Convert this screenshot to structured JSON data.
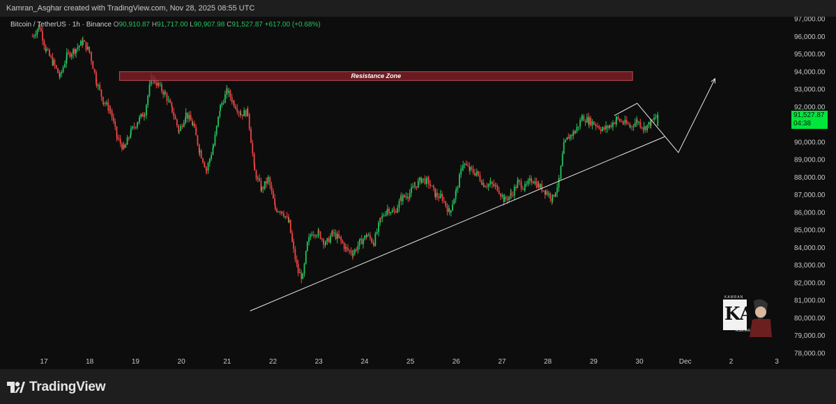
{
  "header": {
    "credit": "Kamran_Asghar created with TradingView.com, Nov 28, 2025 08:55 UTC"
  },
  "legend": {
    "symbol": "Bitcoin / TetherUS · 1h · Binance",
    "o_label": "O",
    "o_value": "90,910.87",
    "h_label": "H",
    "h_value": "91,717.00",
    "l_label": "L",
    "l_value": "90,907.98",
    "c_label": "C",
    "c_value": "91,527.87",
    "change": "+617.00 (+0.68%)"
  },
  "price_tag": {
    "price": "91,527.87",
    "countdown": "04:38"
  },
  "footer": {
    "brand": "TradingView"
  },
  "watermark": {
    "initials": "KA",
    "top_text": "KAMRAN",
    "bottom_text": "ASGHAR"
  },
  "colors": {
    "bg": "#0d0d0d",
    "up": "#22c55e",
    "down": "#ef4444",
    "zone": "#7a1e26",
    "tag": "#00e63b"
  },
  "chart_data": {
    "type": "candlestick",
    "title": "Bitcoin / TetherUS · 1h · Binance",
    "y_ticks": [
      "97,000.00",
      "96,000.00",
      "95,000.00",
      "94,000.00",
      "93,000.00",
      "92,000.00",
      "91,000.00",
      "90,000.00",
      "89,000.00",
      "88,000.00",
      "87,000.00",
      "86,000.00",
      "85,000.00",
      "84,000.00",
      "83,000.00",
      "82,000.00",
      "81,000.00",
      "80,000.00",
      "79,000.00",
      "78,000.00"
    ],
    "ylim": [
      78000,
      97000
    ],
    "x_ticks": [
      "17",
      "18",
      "19",
      "20",
      "21",
      "22",
      "23",
      "24",
      "25",
      "26",
      "27",
      "28",
      "29",
      "30",
      "Dec",
      "2",
      "3"
    ],
    "x_tick_days": [
      17,
      18,
      19,
      20,
      21,
      22,
      23,
      24,
      25,
      26,
      27,
      28,
      29,
      30,
      31,
      32,
      33
    ],
    "price_path": [
      [
        16.75,
        96000
      ],
      [
        16.9,
        96600
      ],
      [
        17.05,
        95200
      ],
      [
        17.2,
        94500
      ],
      [
        17.35,
        93700
      ],
      [
        17.5,
        94900
      ],
      [
        17.7,
        95300
      ],
      [
        17.85,
        95700
      ],
      [
        18.0,
        95100
      ],
      [
        18.15,
        93400
      ],
      [
        18.3,
        92300
      ],
      [
        18.45,
        91800
      ],
      [
        18.6,
        90200
      ],
      [
        18.75,
        89600
      ],
      [
        18.9,
        90600
      ],
      [
        19.05,
        91200
      ],
      [
        19.2,
        91700
      ],
      [
        19.35,
        93700
      ],
      [
        19.5,
        93200
      ],
      [
        19.65,
        92700
      ],
      [
        19.8,
        91800
      ],
      [
        19.95,
        90600
      ],
      [
        20.1,
        91600
      ],
      [
        20.25,
        91000
      ],
      [
        20.4,
        89500
      ],
      [
        20.55,
        88400
      ],
      [
        20.7,
        89800
      ],
      [
        20.85,
        92000
      ],
      [
        21.0,
        92900
      ],
      [
        21.15,
        92200
      ],
      [
        21.3,
        91600
      ],
      [
        21.45,
        91700
      ],
      [
        21.6,
        88300
      ],
      [
        21.75,
        87300
      ],
      [
        21.9,
        87900
      ],
      [
        22.05,
        86200
      ],
      [
        22.2,
        86100
      ],
      [
        22.35,
        85400
      ],
      [
        22.45,
        83800
      ],
      [
        22.55,
        82600
      ],
      [
        22.65,
        82300
      ],
      [
        22.75,
        84200
      ],
      [
        22.85,
        84900
      ],
      [
        23.0,
        84800
      ],
      [
        23.15,
        84200
      ],
      [
        23.3,
        84800
      ],
      [
        23.45,
        84500
      ],
      [
        23.6,
        83900
      ],
      [
        23.75,
        83700
      ],
      [
        23.9,
        84300
      ],
      [
        24.05,
        84700
      ],
      [
        24.2,
        84300
      ],
      [
        24.35,
        85600
      ],
      [
        24.5,
        86200
      ],
      [
        24.65,
        86000
      ],
      [
        24.8,
        86800
      ],
      [
        24.95,
        87000
      ],
      [
        25.1,
        87500
      ],
      [
        25.25,
        87900
      ],
      [
        25.4,
        87700
      ],
      [
        25.55,
        87000
      ],
      [
        25.7,
        86800
      ],
      [
        25.85,
        86000
      ],
      [
        26.0,
        87200
      ],
      [
        26.15,
        88800
      ],
      [
        26.3,
        88400
      ],
      [
        26.45,
        88200
      ],
      [
        26.6,
        87600
      ],
      [
        26.75,
        87600
      ],
      [
        26.9,
        87400
      ],
      [
        27.05,
        86700
      ],
      [
        27.2,
        87000
      ],
      [
        27.35,
        87700
      ],
      [
        27.5,
        87400
      ],
      [
        27.65,
        87900
      ],
      [
        27.8,
        87500
      ],
      [
        27.95,
        87200
      ],
      [
        28.1,
        86800
      ],
      [
        28.25,
        87800
      ],
      [
        28.35,
        89800
      ],
      [
        28.45,
        90300
      ],
      [
        28.6,
        90600
      ],
      [
        28.75,
        91400
      ],
      [
        28.9,
        91200
      ],
      [
        29.05,
        91000
      ],
      [
        29.2,
        90700
      ],
      [
        29.35,
        90900
      ],
      [
        29.5,
        91300
      ],
      [
        29.65,
        91100
      ],
      [
        29.8,
        90900
      ],
      [
        29.95,
        91200
      ],
      [
        30.1,
        90800
      ],
      [
        30.25,
        91100
      ],
      [
        30.4,
        91527.87
      ]
    ],
    "annotations": {
      "resistance_zone": {
        "label": "Resistance Zone",
        "from_day": 18.65,
        "to_day": 29.85,
        "low": 93500,
        "high": 94000
      },
      "trendline": {
        "from": [
          21.5,
          80400
        ],
        "to": [
          30.55,
          90300
        ]
      },
      "projection": [
        [
          29.45,
          91500
        ],
        [
          29.95,
          92200
        ],
        [
          30.85,
          89400
        ],
        [
          31.65,
          93600
        ]
      ]
    },
    "last_price": 91527.87,
    "xlabel": "",
    "ylabel": ""
  }
}
